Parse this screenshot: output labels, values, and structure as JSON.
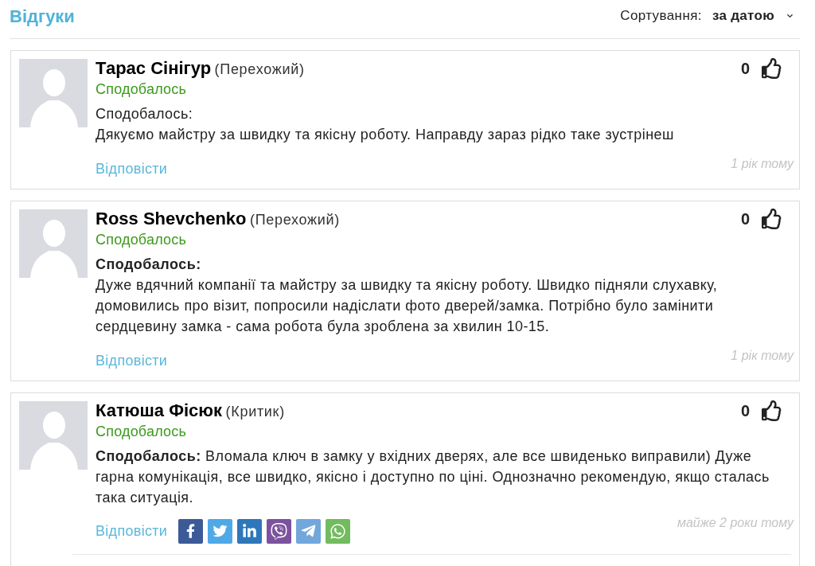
{
  "header": {
    "title": "Відгуки",
    "sort_label": "Сортування:",
    "sort_value": "за датою"
  },
  "reviews": [
    {
      "author": "Тарас Сінігур",
      "role": "(Перехожий)",
      "verdict": "Сподобалось",
      "text": "Сподобалось:\nДякуємо майстру за швидку та якісну роботу. Направду зараз рідко таке зустрінеш",
      "likes": "0",
      "reply": "Відповісти",
      "date": "1 рік тому"
    },
    {
      "author": "Ross Shevchenko",
      "role": "(Перехожий)",
      "verdict": "Сподобалось",
      "text": "**Сподобалось:**\nДуже вдячний компанії та майстру за швидку та якісну роботу. Швидко підняли слухавку, домовились про візит, попросили надіслати фото дверей/замка. Потрібно було замінити сердцевину замка - сама робота була зроблена за хвилин 10-15.",
      "likes": "0",
      "reply": "Відповісти",
      "date": "1 рік тому"
    },
    {
      "author": "Катюша Фісюк",
      "role": "(Критик)",
      "verdict": "Сподобалось",
      "text": "**Сподобалось:** Вломала ключ в замку у вхідних дверях, але все швиденько виправили) Дуже гарна комунікація, все швидко, якісно і доступно по ціні. Однозначно рекомендую, якщо сталась така ситуація.",
      "likes": "0",
      "reply": "Відповісти",
      "date": "майже 2 роки тому",
      "share_buttons": [
        {
          "kind": "facebook"
        },
        {
          "kind": "twitter"
        },
        {
          "kind": "linkedin"
        },
        {
          "kind": "viber"
        },
        {
          "kind": "telegram"
        },
        {
          "kind": "whatsapp"
        }
      ]
    }
  ]
}
